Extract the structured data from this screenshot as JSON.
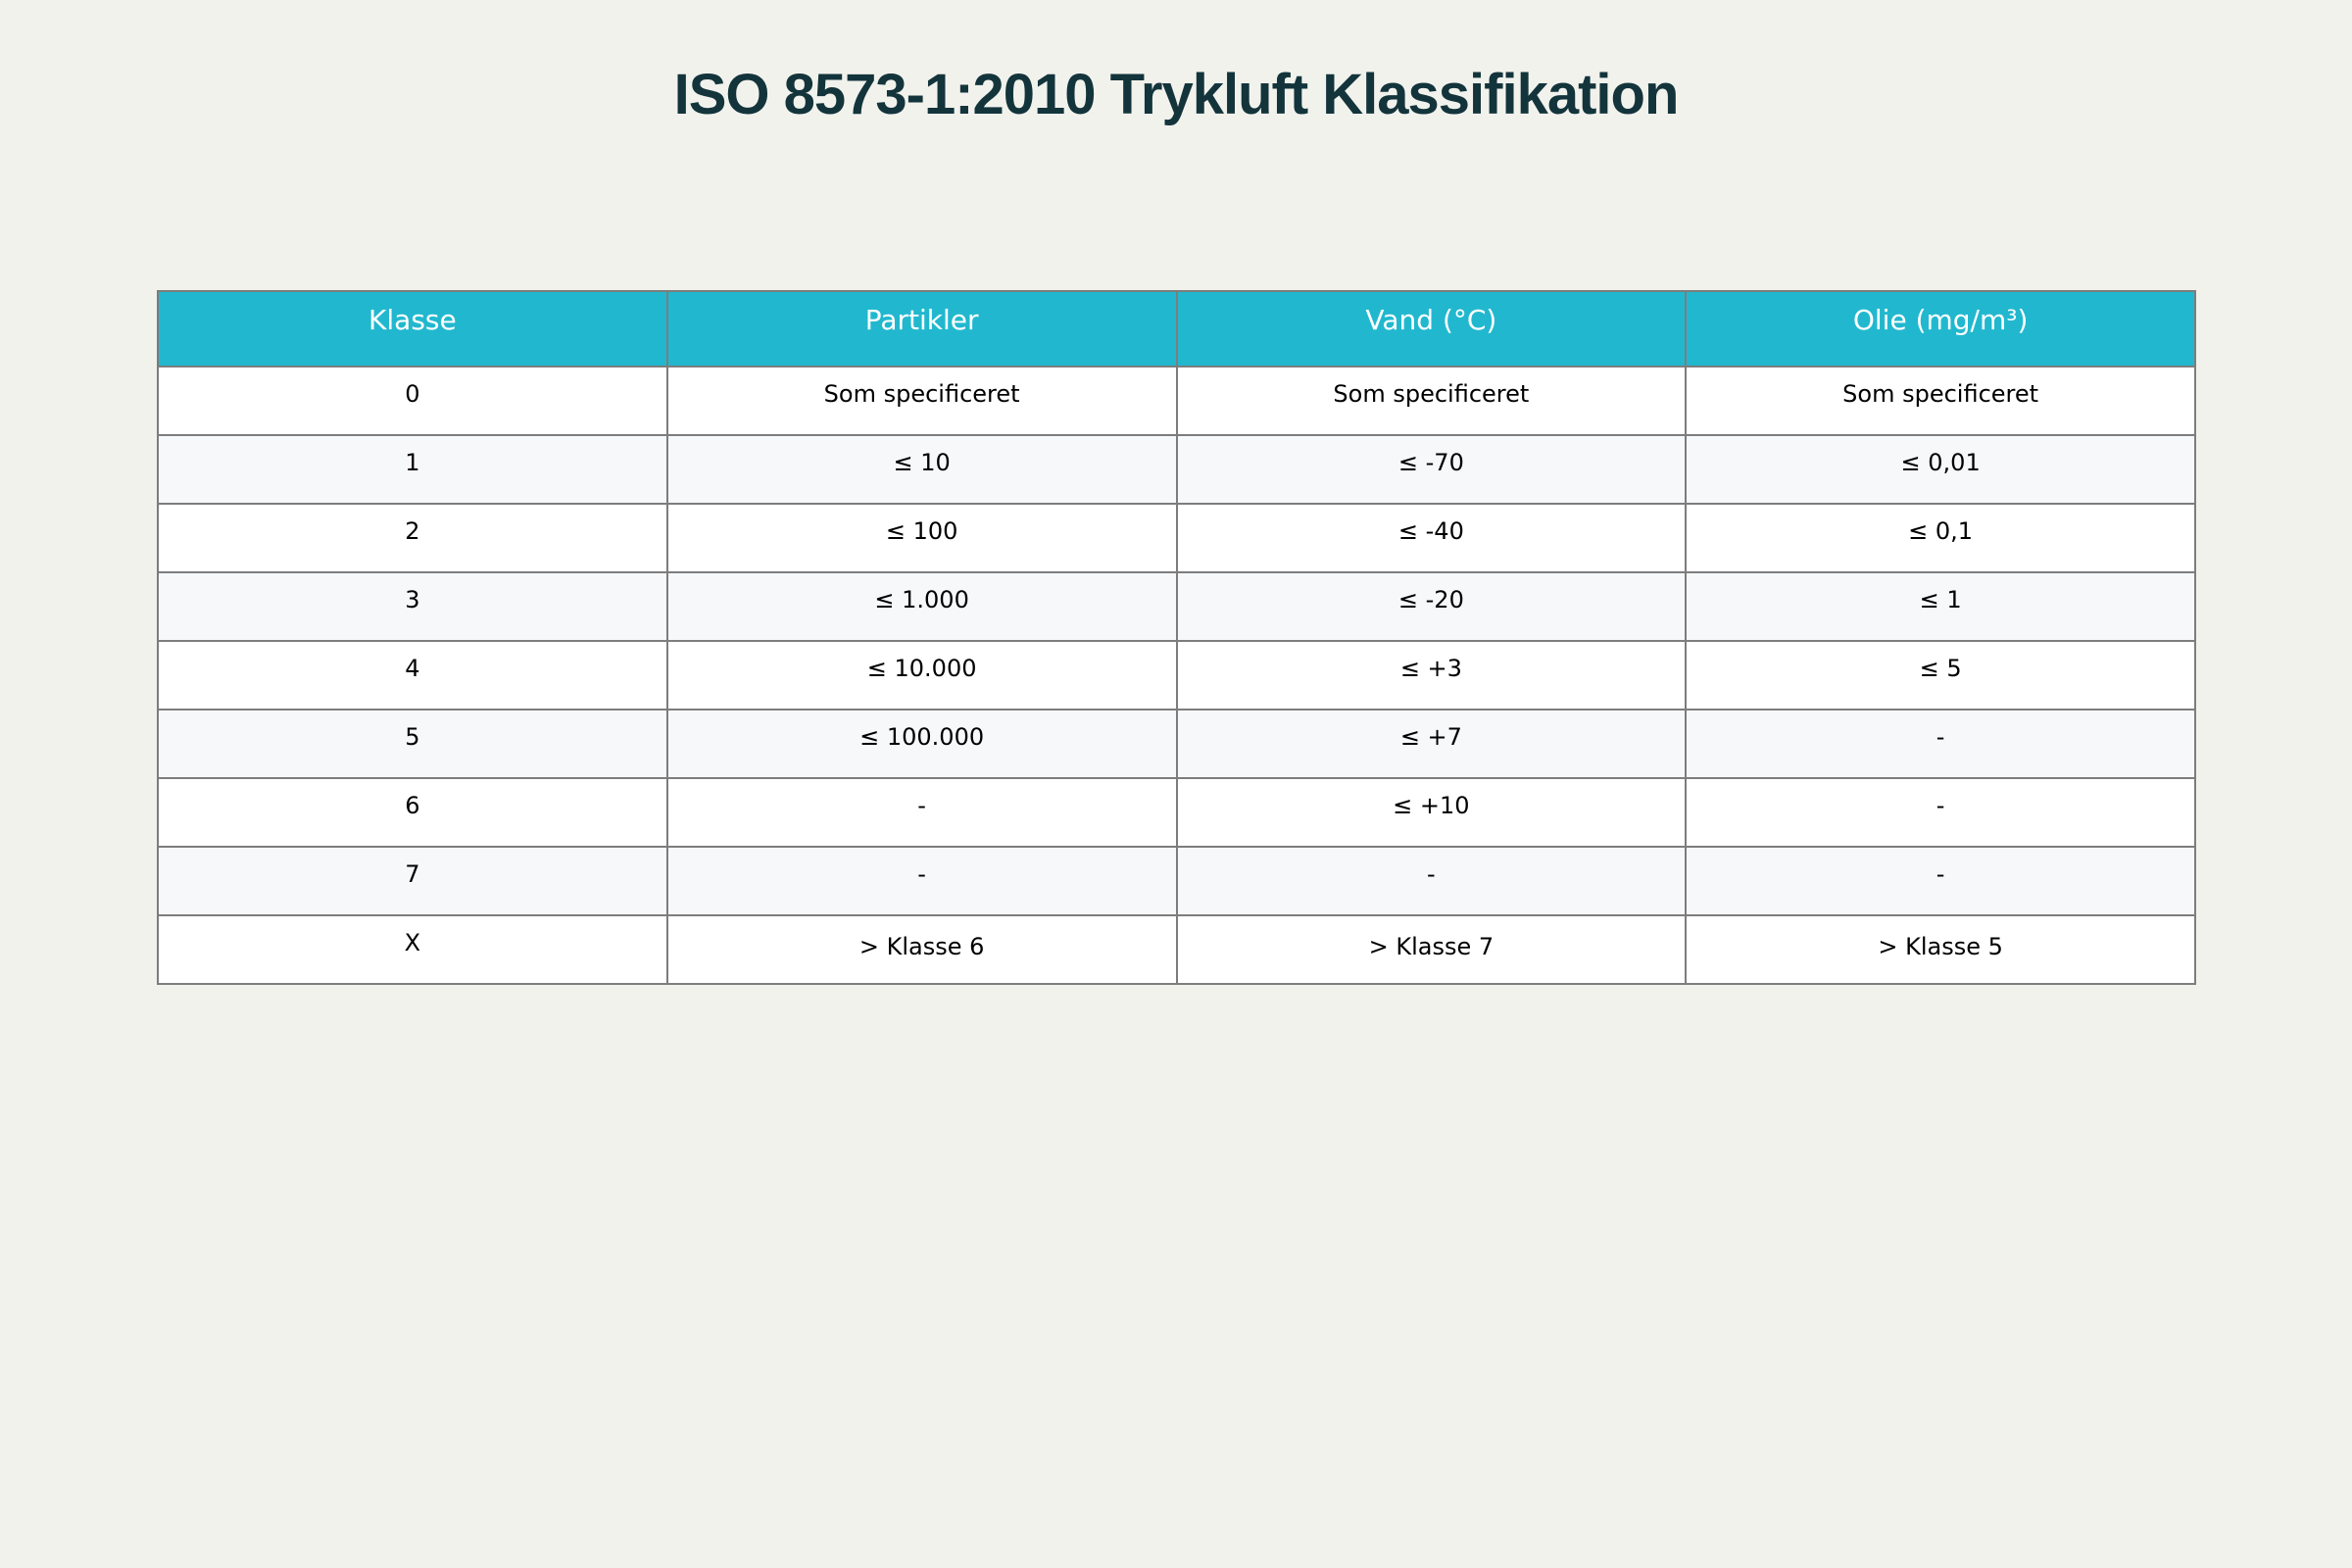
{
  "chart_data": {
    "type": "table",
    "title": "ISO 8573-1:2010 Trykluft Klassifikation",
    "columns": [
      "Klasse",
      "Partikler",
      "Vand (°C)",
      "Olie (mg/m³)"
    ],
    "rows": [
      [
        "0",
        "Som specificeret",
        "Som specificeret",
        "Som specificeret"
      ],
      [
        "1",
        "≤ 10",
        "≤ -70",
        "≤ 0,01"
      ],
      [
        "2",
        "≤ 100",
        "≤ -40",
        "≤ 0,1"
      ],
      [
        "3",
        "≤ 1.000",
        "≤ -20",
        "≤ 1"
      ],
      [
        "4",
        "≤ 10.000",
        "≤ +3",
        "≤ 5"
      ],
      [
        "5",
        "≤ 100.000",
        "≤ +7",
        "-"
      ],
      [
        "6",
        "-",
        "≤ +10",
        "-"
      ],
      [
        "7",
        "-",
        "-",
        "-"
      ],
      [
        "X",
        "> Klasse 6",
        "> Klasse 7",
        "> Klasse 5"
      ]
    ]
  },
  "colors": {
    "header_fill": "#21b8cf",
    "header_text": "#ffffff",
    "title_text": "#13343b",
    "background": "#f2f2ed",
    "row_fill_a": "#ffffff",
    "row_fill_b": "#f7f8fa",
    "border": "#7d7d7d"
  }
}
